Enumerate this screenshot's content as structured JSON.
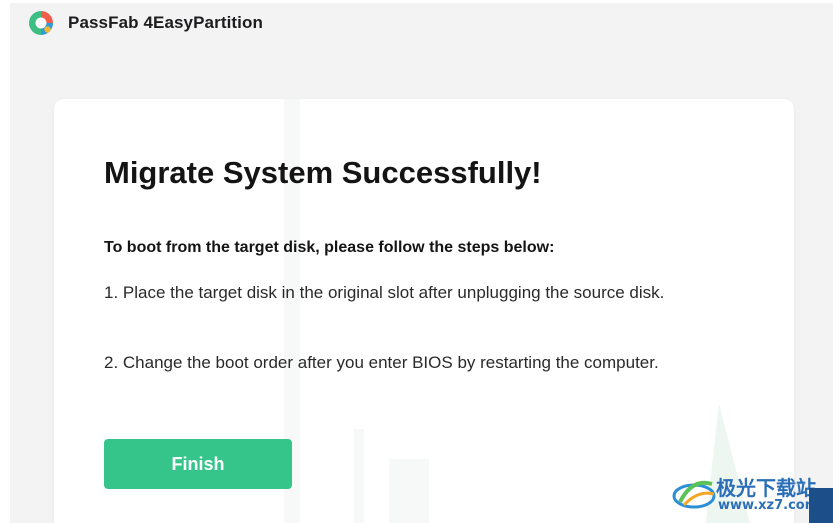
{
  "app": {
    "title": "PassFab 4EasyPartition",
    "logo_icon": "passfab-logo-icon",
    "logo_colors": [
      "#3dbf84",
      "#2d9bd6",
      "#f25c4a",
      "#f5b731"
    ]
  },
  "dialog": {
    "title": "Migrate System Successfully!",
    "steps_heading": "To boot from the target disk, please follow the steps below:",
    "steps": [
      "1. Place the target disk in the original slot after unplugging the source disk.",
      "2. Change the boot order after you enter BIOS by restarting the computer."
    ],
    "finish_label": "Finish"
  },
  "watermark": {
    "text_cn": "极光下载站",
    "url": "www.xz7.com",
    "icon": "aurora-logo-icon"
  },
  "colors": {
    "accent": "#35c58b",
    "window_bg": "#f3f3f4",
    "card_bg": "#ffffff",
    "text": "#141414"
  }
}
